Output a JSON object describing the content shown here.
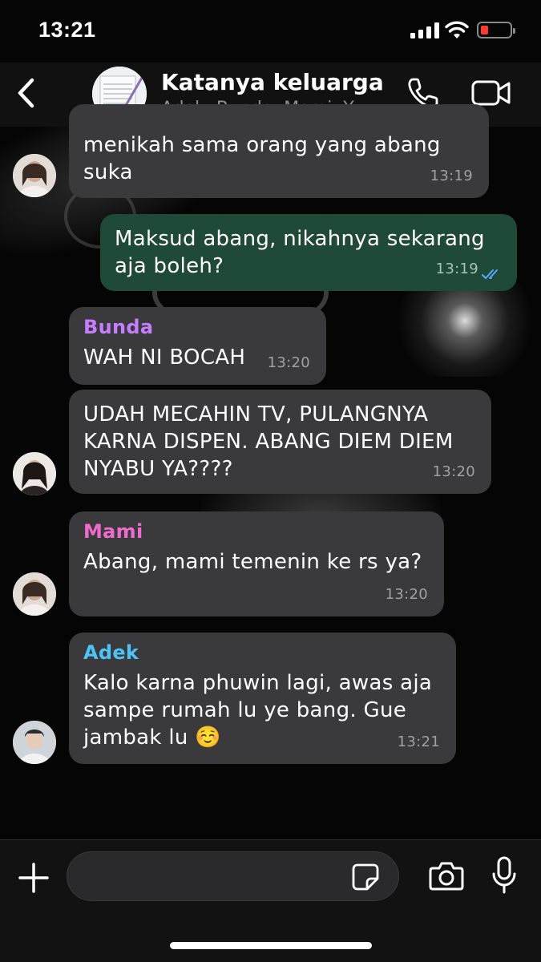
{
  "status_bar": {
    "time": "13:21"
  },
  "header": {
    "title": "Katanya keluarga",
    "subtitle": "Adek, Bunda, Mami, Y..."
  },
  "messages": [
    {
      "type": "in",
      "text_lines": [
        "menikah sama orang yang abang",
        "suka"
      ],
      "time": "13:19"
    },
    {
      "type": "out",
      "text_lines": [
        "Maksud abang, nikahnya sekarang",
        "aja boleh?"
      ],
      "time": "13:19"
    },
    {
      "type": "in",
      "sender": "Bunda",
      "text_lines": [
        "WAH NI BOCAH"
      ],
      "time": "13:20"
    },
    {
      "type": "in",
      "text_lines": [
        "UDAH MECAHIN TV, PULANGNYA",
        "KARNA DISPEN. ABANG DIEM DIEM",
        "NYABU YA????"
      ],
      "time": "13:20"
    },
    {
      "type": "in",
      "sender": "Mami",
      "text_lines": [
        "Abang, mami temenin ke rs ya?"
      ],
      "time": "13:20"
    },
    {
      "type": "in",
      "sender": "Adek",
      "text_lines": [
        "Kalo karna phuwin lagi, awas aja",
        "sampe rumah lu ye bang. Gue",
        "jambak lu ☺️"
      ],
      "time": "13:21"
    }
  ],
  "colors": {
    "bunda": "#c77dff",
    "mami": "#f06bd0",
    "adek": "#4fc3f7",
    "incoming_bubble": "#3a3a3c",
    "outgoing_bubble": "#1f4a38",
    "read_ticks": "#5aa7ff"
  },
  "input": {
    "value": "",
    "placeholder": ""
  }
}
